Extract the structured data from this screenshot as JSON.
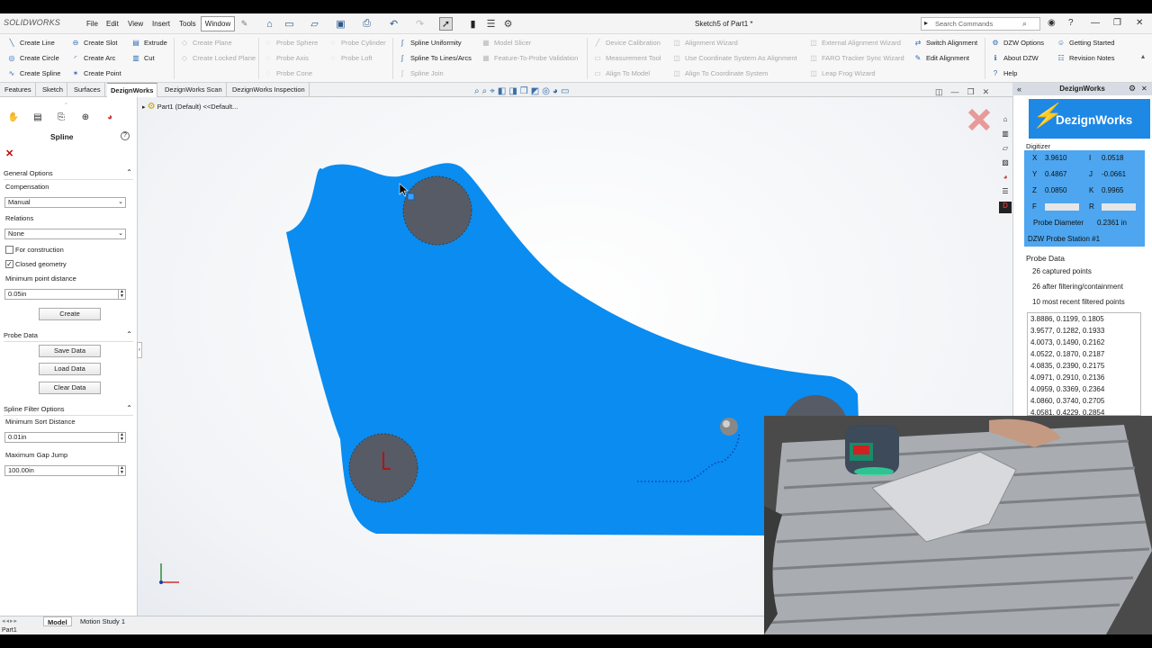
{
  "app": {
    "brand": "SOLIDWORKS",
    "doc_title": "Sketch5 of Part1 *",
    "status": "Part1"
  },
  "menu": [
    "File",
    "Edit",
    "View",
    "Insert",
    "Tools",
    "Window"
  ],
  "search": {
    "placeholder": "Search Commands"
  },
  "ribbon": {
    "col1": [
      "Create Line",
      "Create Circle",
      "Create Spline"
    ],
    "col2": [
      "Create Slot",
      "Create Arc",
      "Create Point"
    ],
    "col3": [
      "Extrude",
      "Cut"
    ],
    "col4": [
      "Create Plane",
      "Create Locked Plane"
    ],
    "col5": [
      "Probe Sphere",
      "Probe Axis",
      "Probe Cone"
    ],
    "col6": [
      "Probe Cylinder",
      "Probe Loft"
    ],
    "col7": [
      "Spline Uniformity",
      "Spline To Lines/Arcs",
      "Spline Join"
    ],
    "col8": [
      "Model Slicer",
      "Feature-To-Probe Validation"
    ],
    "col9": [
      "Device Calibration",
      "Measurement Tool",
      "Align To Model"
    ],
    "col10": [
      "Alignment Wizard",
      "Use Coordinate System As Alignment",
      "Align To Coordinate System"
    ],
    "col11": [
      "External Alignment Wizard",
      "FARO Tracker Sync Wizard",
      "Leap Frog Wizard"
    ],
    "col12": [
      "Switch Alignment",
      "Edit Alignment"
    ],
    "col13": [
      "DZW Options",
      "About DZW",
      "Help"
    ],
    "col14": [
      "Getting Started",
      "Revision Notes"
    ]
  },
  "tabs": [
    "Features",
    "Sketch",
    "Surfaces",
    "DezignWorks",
    "DezignWorks Scan",
    "DezignWorks Inspection"
  ],
  "active_tab": "DezignWorks",
  "tree": {
    "root": "Part1 (Default) <<Default..."
  },
  "left_panel": {
    "title": "Spline",
    "general_options": "General Options",
    "compensation_label": "Compensation",
    "compensation_value": "Manual",
    "relations_label": "Relations",
    "relations_value": "None",
    "for_construction": "For construction",
    "closed_geometry": "Closed geometry",
    "min_point_distance_label": "Minimum point distance",
    "min_point_distance": "0.05in",
    "create": "Create",
    "probe_data": "Probe Data",
    "save_data": "Save Data",
    "load_data": "Load Data",
    "clear_data": "Clear Data",
    "spline_filter": "Spline Filter Options",
    "min_sort_label": "Minimum Sort Distance",
    "min_sort": "0.01in",
    "max_gap_label": "Maximum Gap Jump",
    "max_gap": "100.00in",
    "for_construction_checked": false,
    "closed_geometry_checked": true
  },
  "bottom_tabs": [
    "Model",
    "Motion Study 1"
  ],
  "right_panel": {
    "title": "DezignWorks",
    "logo_text": "DezignWorks",
    "digitizer_label": "Digitizer",
    "X": "3.9610",
    "Y": "0.4867",
    "Z": "0.0850",
    "I": "0.0518",
    "J": "-0.0661",
    "K": "0.9965",
    "F_label": "F",
    "R_label": "R",
    "probe_diameter_label": "Probe Diameter",
    "probe_diameter": "0.2361 in",
    "probe_station": "DZW Probe Station #1",
    "probe_data_title": "Probe Data",
    "captured": "26 captured points",
    "filtered": "26 after filtering/containment",
    "recent": "10  most recent filtered points",
    "points": [
      "3.8886, 0.1199, 0.1805",
      "3.9577, 0.1282, 0.1933",
      "4.0073, 0.1490, 0.2162",
      "4.0522, 0.1870, 0.2187",
      "4.0835, 0.2390, 0.2175",
      "4.0971, 0.2910, 0.2136",
      "4.0959, 0.3369, 0.2364",
      "4.0860, 0.3740, 0.2705",
      "4.0581, 0.4229, 0.2854"
    ]
  },
  "colors": {
    "part_blue": "#0a8cf0",
    "hole_gray": "#575b65",
    "accent": "#1e88e5",
    "brand_red": "#c8102e"
  }
}
